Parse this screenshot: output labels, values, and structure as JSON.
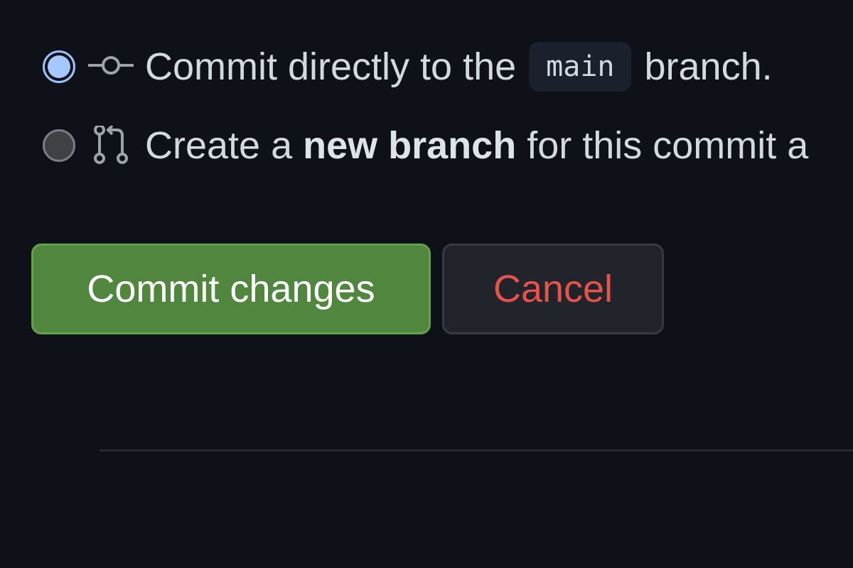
{
  "commit_options": {
    "direct": {
      "text_before": "Commit directly to the",
      "branch_name": "main",
      "text_after": "branch.",
      "selected": true,
      "icon": "git-commit-icon"
    },
    "new_branch": {
      "text_before": "Create a",
      "text_bold": "new branch",
      "text_after": "for this commit a",
      "selected": false,
      "icon": "git-pull-request-icon"
    }
  },
  "actions": {
    "commit_label": "Commit changes",
    "cancel_label": "Cancel"
  },
  "colors": {
    "background": "#0e1117",
    "primary_button": "#50863e",
    "danger_text": "#e5534b",
    "radio_selected": "#a5c8ff"
  }
}
